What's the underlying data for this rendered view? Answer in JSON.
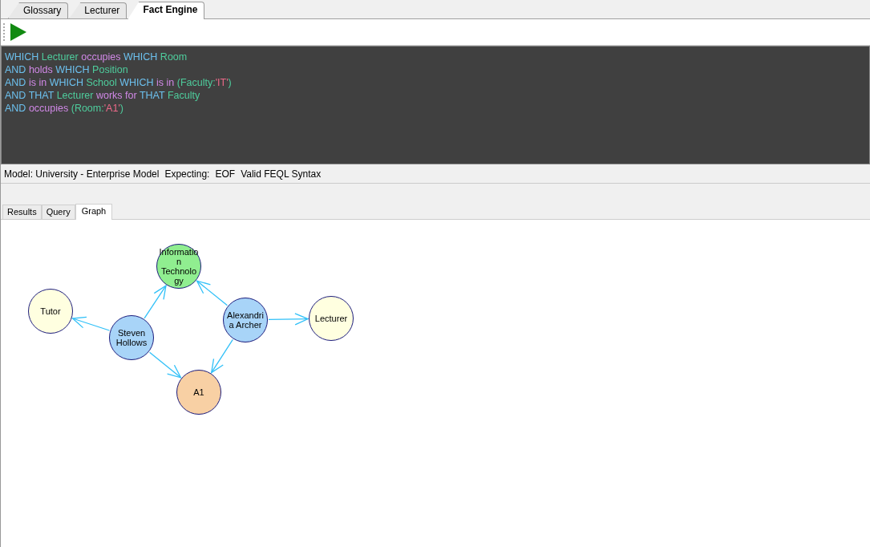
{
  "document_tabs": [
    {
      "label": "Glossary",
      "selected": false
    },
    {
      "label": "Lecturer",
      "selected": false
    },
    {
      "label": "Fact Engine",
      "selected": true
    }
  ],
  "query_editor": {
    "lines": [
      [
        [
          {
            "text": "WHICH",
            "kind": "keyword"
          }
        ],
        [
          {
            "text": "Lecturer",
            "kind": "term"
          }
        ],
        [
          {
            "text": "occupies",
            "kind": "predicate"
          }
        ],
        [
          {
            "text": "WHICH",
            "kind": "keyword"
          }
        ],
        [
          {
            "text": "Room",
            "kind": "term"
          }
        ]
      ],
      [
        [
          {
            "text": "AND",
            "kind": "keyword"
          }
        ],
        [
          {
            "text": "holds",
            "kind": "predicate"
          }
        ],
        [
          {
            "text": "WHICH",
            "kind": "keyword"
          }
        ],
        [
          {
            "text": "Position",
            "kind": "term"
          }
        ]
      ],
      [
        [
          {
            "text": "AND",
            "kind": "keyword"
          }
        ],
        [
          {
            "text": "is",
            "kind": "predicate"
          }
        ],
        [
          {
            "text": "in",
            "kind": "predicate"
          }
        ],
        [
          {
            "text": "WHICH",
            "kind": "keyword"
          }
        ],
        [
          {
            "text": "School",
            "kind": "term"
          }
        ],
        [
          {
            "text": "WHICH",
            "kind": "keyword"
          }
        ],
        [
          {
            "text": "is",
            "kind": "predicate"
          }
        ],
        [
          {
            "text": "in",
            "kind": "predicate"
          }
        ],
        [
          {
            "text": "(Faculty:",
            "kind": "term"
          },
          {
            "text": "'IT'",
            "kind": "string"
          },
          {
            "text": ")",
            "kind": "term"
          }
        ]
      ],
      [
        [
          {
            "text": "AND",
            "kind": "keyword"
          }
        ],
        [
          {
            "text": "THAT",
            "kind": "keyword"
          }
        ],
        [
          {
            "text": "Lecturer",
            "kind": "term"
          }
        ],
        [
          {
            "text": "works",
            "kind": "predicate"
          }
        ],
        [
          {
            "text": "for",
            "kind": "predicate"
          }
        ],
        [
          {
            "text": "THAT",
            "kind": "keyword"
          }
        ],
        [
          {
            "text": "Faculty",
            "kind": "term"
          }
        ]
      ],
      [
        [
          {
            "text": "AND",
            "kind": "keyword"
          }
        ],
        [
          {
            "text": "occupies",
            "kind": "predicate"
          }
        ],
        [
          {
            "text": "(Room:",
            "kind": "term"
          },
          {
            "text": "'A1'",
            "kind": "string"
          },
          {
            "text": ")",
            "kind": "term"
          }
        ]
      ]
    ]
  },
  "status_bar": [
    "Model: University - Enterprise Model",
    "Expecting:",
    "EOF",
    "Valid FEQL Syntax"
  ],
  "result_tabs": [
    {
      "label": "Results",
      "selected": false
    },
    {
      "label": "Query",
      "selected": false
    },
    {
      "label": "Graph",
      "selected": true
    }
  ],
  "graph": {
    "nodes": [
      {
        "label": "Tutor",
        "color": "#ffffe0"
      },
      {
        "label": "Steven Hollows",
        "color": "#a8d4f8"
      },
      {
        "label": "Information Technology",
        "color": "#90ee90"
      },
      {
        "label": "Alexandria Archer",
        "color": "#a8d4f8"
      },
      {
        "label": "Lecturer",
        "color": "#ffffe0"
      },
      {
        "label": "A1",
        "color": "#f8d0a4"
      }
    ]
  }
}
